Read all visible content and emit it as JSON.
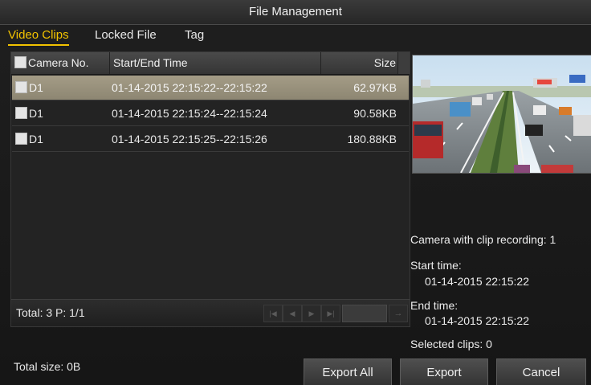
{
  "window": {
    "title": "File Management"
  },
  "tabs": [
    {
      "label": "Video Clips",
      "active": true
    },
    {
      "label": "Locked File",
      "active": false
    },
    {
      "label": "Tag",
      "active": false
    }
  ],
  "table": {
    "columns": {
      "camera": "Camera No.",
      "time": "Start/End Time",
      "size": "Size"
    },
    "rows": [
      {
        "camera": "D1",
        "time": "01-14-2015 22:15:22--22:15:22",
        "size": "62.97KB",
        "selected": true
      },
      {
        "camera": "D1",
        "time": "01-14-2015 22:15:24--22:15:24",
        "size": "90.58KB",
        "selected": false
      },
      {
        "camera": "D1",
        "time": "01-14-2015 22:15:25--22:15:26",
        "size": "180.88KB",
        "selected": false
      }
    ],
    "footer": {
      "total": "Total: 3  P: 1/1",
      "page_input": ""
    }
  },
  "pager_icons": [
    "first-page-icon",
    "prev-page-icon",
    "next-page-icon",
    "last-page-icon",
    "go-arrow-icon"
  ],
  "info": {
    "camera_recording": "Camera with clip recording: 1",
    "start_label": "Start time:",
    "start_value": "01-14-2015 22:15:22",
    "end_label": "End time:",
    "end_value": "01-14-2015 22:15:22",
    "selected_clips": "Selected clips: 0"
  },
  "bottom": {
    "total_size": "Total size: 0B",
    "export_all": "Export All",
    "export": "Export",
    "cancel": "Cancel"
  },
  "colors": {
    "accent": "#f2c200",
    "selected_row": "#9a927d",
    "background": "#1b1b1b"
  }
}
